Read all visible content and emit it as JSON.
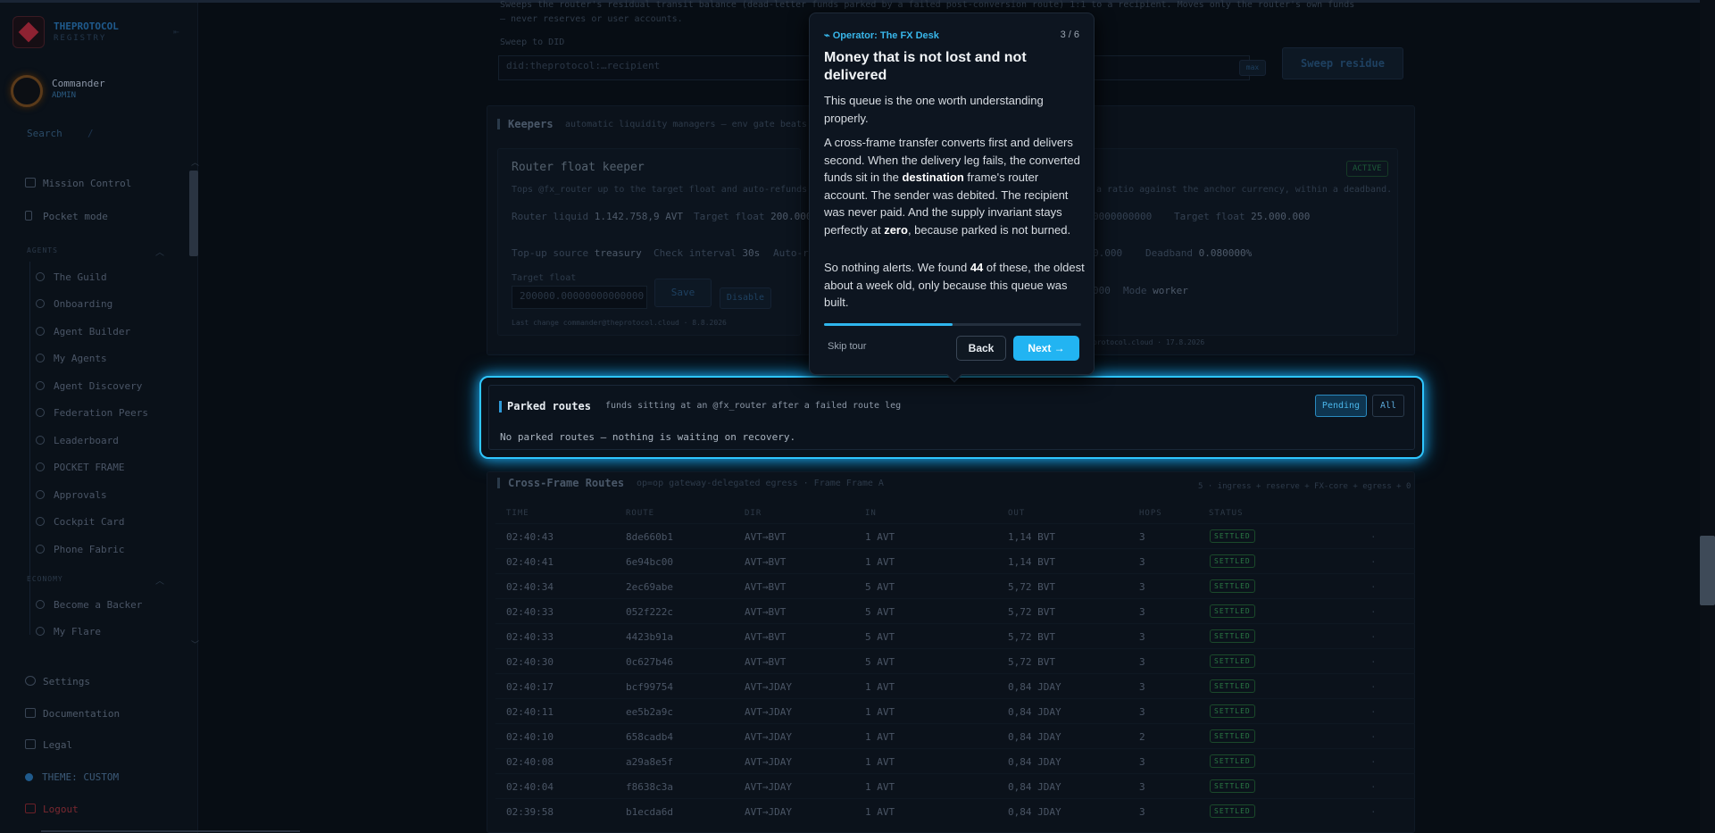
{
  "brand": {
    "title": "THEPROTOCOL",
    "subtitle": "REGISTRY"
  },
  "user": {
    "name": "Commander",
    "role": "ADMIN"
  },
  "search": {
    "placeholder": "Search",
    "shortcut": "/"
  },
  "nav": {
    "mission_control": "Mission Control",
    "pocket_mode": "Pocket mode",
    "agents_section": "AGENTS",
    "agents": [
      "The Guild",
      "Onboarding",
      "Agent Builder",
      "My Agents",
      "Agent Discovery",
      "Federation Peers",
      "Leaderboard",
      "POCKET FRAME",
      "Approvals",
      "Cockpit Card",
      "Phone Fabric"
    ],
    "economy_section": "ECONOMY",
    "economy": [
      "Become a Backer",
      "My Flare"
    ],
    "settings": "Settings",
    "documentation": "Documentation",
    "legal": "Legal",
    "theme": "THEME: CUSTOM",
    "logout": "Logout"
  },
  "sweep": {
    "desc1": "Sweeps the router's residual transit balance (dead-letter funds parked by a failed post-conversion route) 1:1 to a recipient. Moves only the router's own funds",
    "desc2": "— never reserves or user accounts.",
    "label": "Sweep to DID",
    "placeholder": "did:theprotocol:…recipient",
    "max": "max",
    "button": "Sweep residue"
  },
  "keepers": {
    "title": "Keepers",
    "desc": "automatic liquidity managers — env gate beats",
    "router_float": {
      "title": "Router float keeper",
      "desc": "Tops @fx_router up to the target float and auto-refunds parked",
      "router_liquid_label": "Router liquid",
      "router_liquid": "1.142.758,9 AVT",
      "target_float_label": "Target float",
      "target_float": "200.000",
      "topup_label": "Top-up source",
      "topup": "treasury",
      "interval_label": "Check interval",
      "interval": "30s",
      "auto_label": "Auto-r",
      "field_label": "Target float",
      "field_value": "200000.00000000000000",
      "save": "Save",
      "disable": "Disable",
      "last_change": "Last change commander@theprotocol.cloud · 8.8.2026"
    },
    "right": {
      "desc": "a ratio against the anchor currency, within a deadband.",
      "active": "ACTIVE",
      "val1": "0000000000",
      "target_float_label": "Target float",
      "target_float": "25.000.000",
      "val2": "0.000",
      "deadband_label": "Deadband",
      "deadband": "0.080000%",
      "val3": "000",
      "mode_label": "Mode",
      "mode": "worker",
      "footer": "protocol.cloud · 17.8.2026"
    }
  },
  "parked": {
    "title": "Parked routes",
    "desc": "funds sitting at an @fx_router after a failed route leg",
    "empty": "No parked routes — nothing is waiting on recovery.",
    "pending": "Pending",
    "all": "All"
  },
  "routes": {
    "title": "Cross-Frame Routes",
    "desc": "op=op gateway-delegated egress · Frame Frame A",
    "right": "5 · ingress + reserve + FX-core + egress + 0",
    "headers": [
      "TIME",
      "ROUTE",
      "DIR",
      "IN",
      "OUT",
      "HOPS",
      "STATUS"
    ],
    "rows": [
      [
        "02:40:43",
        "8de660b1",
        "AVT→BVT",
        "1 AVT",
        "1,14 BVT",
        "3",
        "SETTLED"
      ],
      [
        "02:40:41",
        "6e94bc00",
        "AVT→BVT",
        "1 AVT",
        "1,14 BVT",
        "3",
        "SETTLED"
      ],
      [
        "02:40:34",
        "2ec69abe",
        "AVT→BVT",
        "5 AVT",
        "5,72 BVT",
        "3",
        "SETTLED"
      ],
      [
        "02:40:33",
        "052f222c",
        "AVT→BVT",
        "5 AVT",
        "5,72 BVT",
        "3",
        "SETTLED"
      ],
      [
        "02:40:33",
        "4423b91a",
        "AVT→BVT",
        "5 AVT",
        "5,72 BVT",
        "3",
        "SETTLED"
      ],
      [
        "02:40:30",
        "0c627b46",
        "AVT→BVT",
        "5 AVT",
        "5,72 BVT",
        "3",
        "SETTLED"
      ],
      [
        "02:40:17",
        "bcf99754",
        "AVT→JDAY",
        "1 AVT",
        "0,84 JDAY",
        "3",
        "SETTLED"
      ],
      [
        "02:40:11",
        "ee5b2a9c",
        "AVT→JDAY",
        "1 AVT",
        "0,84 JDAY",
        "3",
        "SETTLED"
      ],
      [
        "02:40:10",
        "658cadb4",
        "AVT→JDAY",
        "1 AVT",
        "0,84 JDAY",
        "2",
        "SETTLED"
      ],
      [
        "02:40:08",
        "a29a8e5f",
        "AVT→JDAY",
        "1 AVT",
        "0,84 JDAY",
        "3",
        "SETTLED"
      ],
      [
        "02:40:04",
        "f8638c3a",
        "AVT→JDAY",
        "1 AVT",
        "0,84 JDAY",
        "3",
        "SETTLED"
      ],
      [
        "02:39:58",
        "b1ecda6d",
        "AVT→JDAY",
        "1 AVT",
        "0,84 JDAY",
        "3",
        "SETTLED"
      ]
    ]
  },
  "tour": {
    "header": "Operator: The FX Desk",
    "step": "3 / 6",
    "progress": 0.5,
    "title": "Money that is not lost and not delivered",
    "p1": "This queue is the one worth understanding properly.",
    "p2_a": "A cross-frame transfer converts first and delivers second. When the delivery leg fails, the converted funds sit in the ",
    "p2_b1": "destination",
    "p2_c": " frame's router account. The sender was debited. The recipient was never paid. And the supply invariant stays perfectly at ",
    "p2_b2": "zero",
    "p2_d": ", because parked is not burned.",
    "p3_a": "So nothing alerts. We found ",
    "p3_b": "44",
    "p3_c": " of these, the oldest about a week old, only because this queue was built.",
    "skip": "Skip tour",
    "back": "Back",
    "next": "Next →"
  }
}
